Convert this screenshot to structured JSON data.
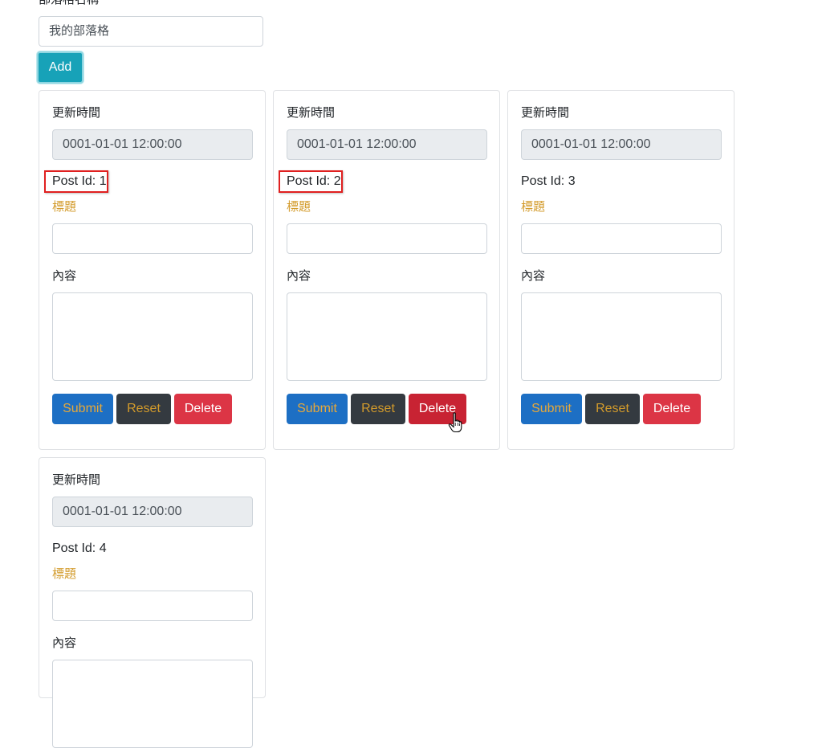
{
  "blog": {
    "label": "部落格名稱",
    "input_value": "我的部落格",
    "add_label": "Add"
  },
  "cards": [
    {
      "updated_label": "更新時間",
      "updated_value": "0001-01-01 12:00:00",
      "post_id": "Post Id: 1",
      "title_label": "標題",
      "title_value": "",
      "content_label": "內容",
      "content_value": "",
      "submit": "Submit",
      "reset": "Reset",
      "delete": "Delete"
    },
    {
      "updated_label": "更新時間",
      "updated_value": "0001-01-01 12:00:00",
      "post_id": "Post Id: 2",
      "title_label": "標題",
      "title_value": "",
      "content_label": "內容",
      "content_value": "",
      "submit": "Submit",
      "reset": "Reset",
      "delete": "Delete"
    },
    {
      "updated_label": "更新時間",
      "updated_value": "0001-01-01 12:00:00",
      "post_id": "Post Id: 3",
      "title_label": "標題",
      "title_value": "",
      "content_label": "內容",
      "content_value": "",
      "submit": "Submit",
      "reset": "Reset",
      "delete": "Delete"
    },
    {
      "updated_label": "更新時間",
      "updated_value": "0001-01-01 12:00:00",
      "post_id": "Post Id: 4",
      "title_label": "標題",
      "title_value": "",
      "content_label": "內容",
      "content_value": ""
    }
  ],
  "colors": {
    "add_button": "#17a2b8",
    "submit_button": "#1d6fc4",
    "reset_button": "#343a40",
    "delete_button": "#dc3545",
    "title_label": "#d39b2b",
    "highlight_box": "#e02020"
  },
  "icons": {
    "cursor": "hand-pointer-icon"
  }
}
